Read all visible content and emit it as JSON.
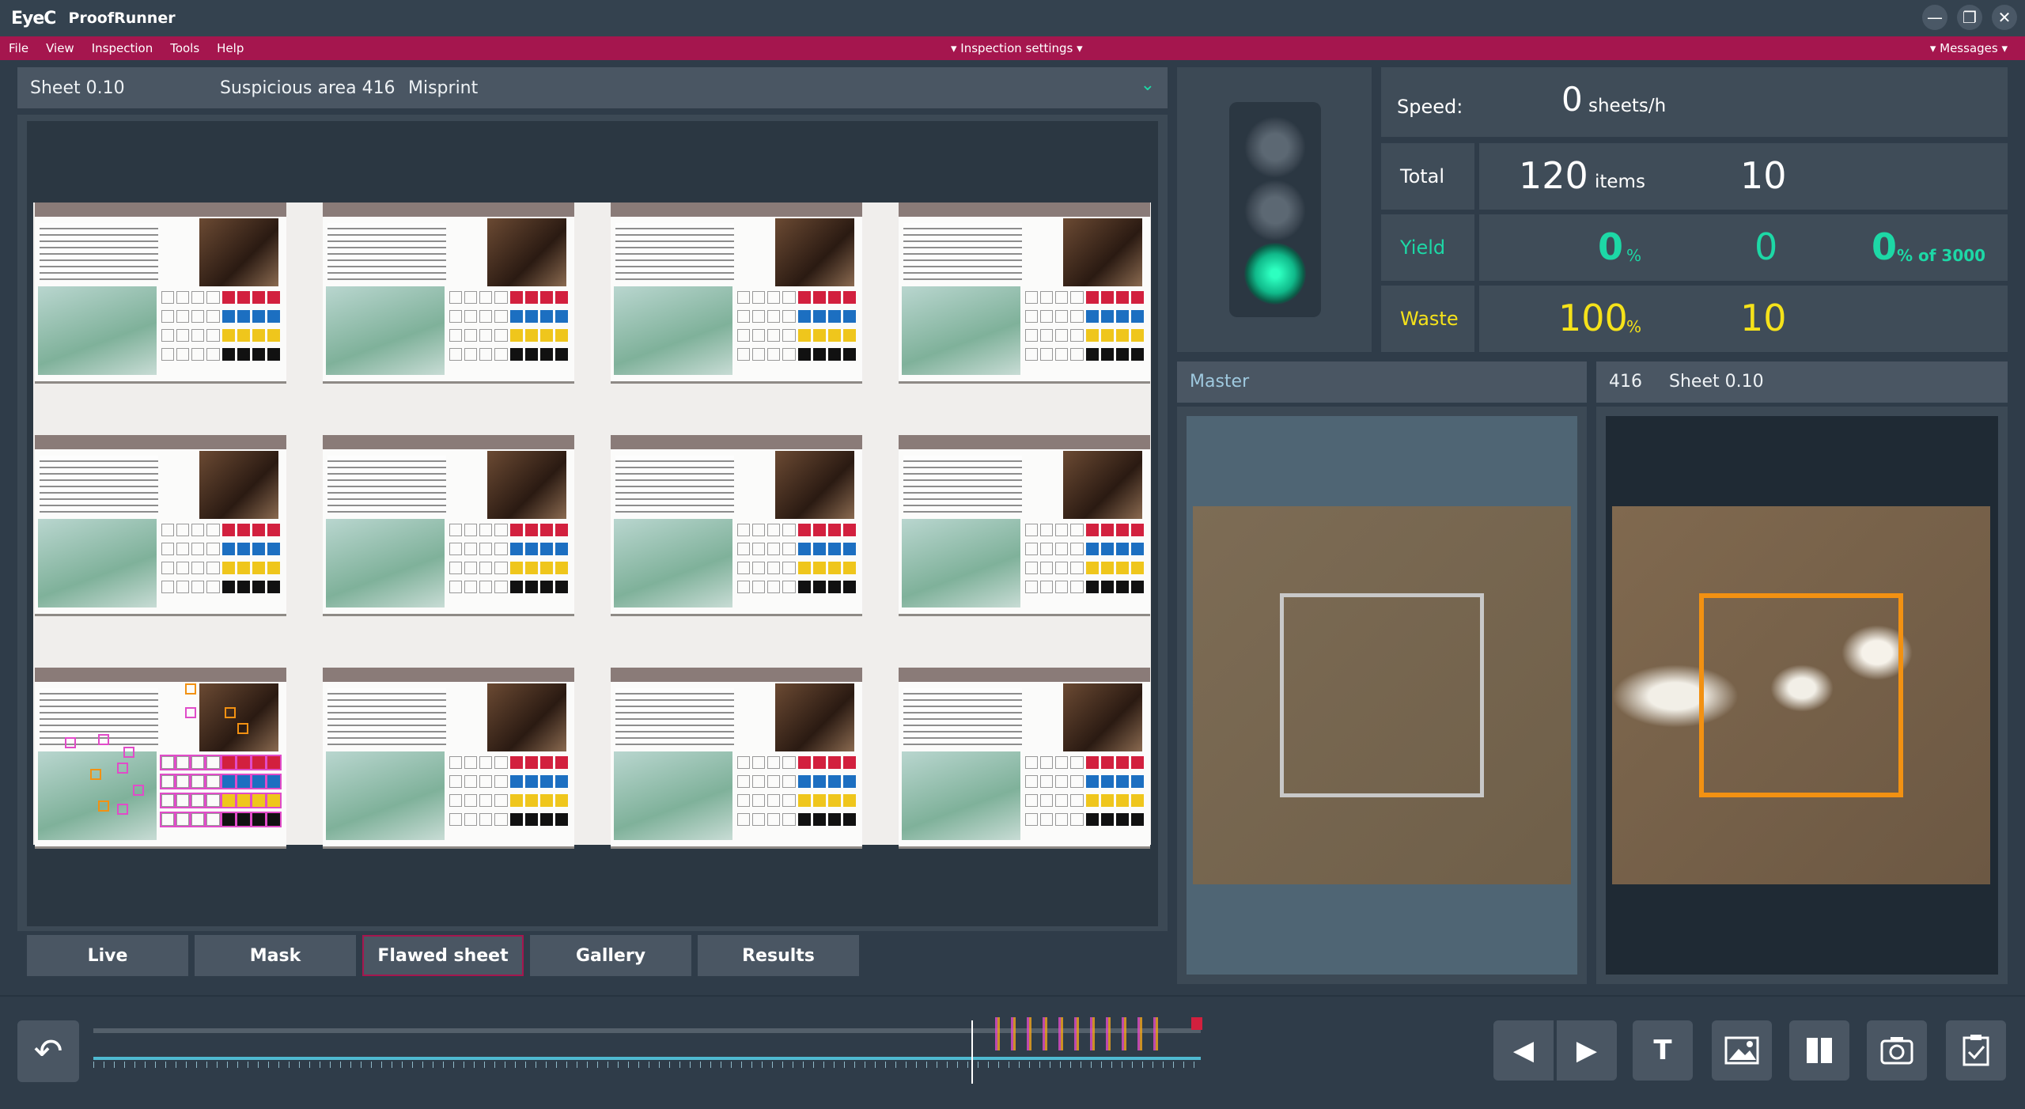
{
  "app": {
    "logo": "EyeC",
    "title": "ProofRunner"
  },
  "window_buttons": {
    "minimize": "—",
    "restore": "❐",
    "close": "✕"
  },
  "menu": {
    "items": [
      "File",
      "View",
      "Inspection",
      "Tools",
      "Help"
    ],
    "inspection_settings": "▾ Inspection settings ▾",
    "messages": "▾ Messages ▾"
  },
  "sheet_header": {
    "sheet": "Sheet  0.10",
    "area": "Suspicious area 416",
    "type": "Misprint",
    "chevron": "⌄"
  },
  "tabs": [
    "Live",
    "Mask",
    "Flawed sheet",
    "Gallery",
    "Results"
  ],
  "active_tab": "Flawed sheet",
  "stats": {
    "speed_label": "Speed:",
    "speed_value": "0",
    "speed_unit": "sheets/h",
    "total_label": "Total",
    "total_items": "120",
    "total_unit": "items",
    "total_sheets": "10",
    "yield_label": "Yield",
    "yield_pct": "0",
    "yield_pct_unit": "%",
    "yield_count": "0",
    "yield_target": "0",
    "yield_target_unit": "% of 3000",
    "waste_label": "Waste",
    "waste_pct": "100",
    "waste_pct_unit": "%",
    "waste_count": "10"
  },
  "colors": {
    "menu_bg": "#a5164e",
    "yield": "#1dd8a6",
    "waste": "#f5e21a",
    "flaw_box": "#f29112",
    "master_box": "#c8c8c8"
  },
  "master_panel": {
    "title": "Master"
  },
  "flaw_panel": {
    "id": "416",
    "sheet": "Sheet 0.10"
  },
  "bottom_bar": {
    "undo_icon": "↶",
    "prev_icon": "◀",
    "next_icon": "▶",
    "text_icon": "T"
  }
}
